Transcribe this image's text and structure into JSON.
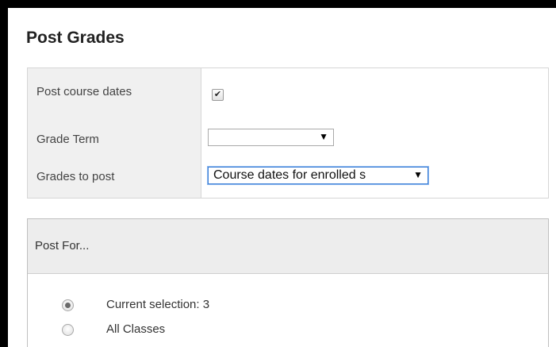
{
  "dialog": {
    "title": "Post Grades"
  },
  "settings": {
    "post_course_dates": {
      "label": "Post course dates",
      "checked": true,
      "check_glyph": "✔"
    },
    "grade_term": {
      "label": "Grade Term",
      "value": ""
    },
    "grades_to_post": {
      "label": "Grades to post",
      "value": "Course dates for enrolled s"
    },
    "dropdown_arrow": "▼"
  },
  "post_for": {
    "header": "Post For...",
    "options": [
      {
        "label": "Current selection: 3",
        "selected": true
      },
      {
        "label": "All Classes",
        "selected": false
      }
    ]
  }
}
